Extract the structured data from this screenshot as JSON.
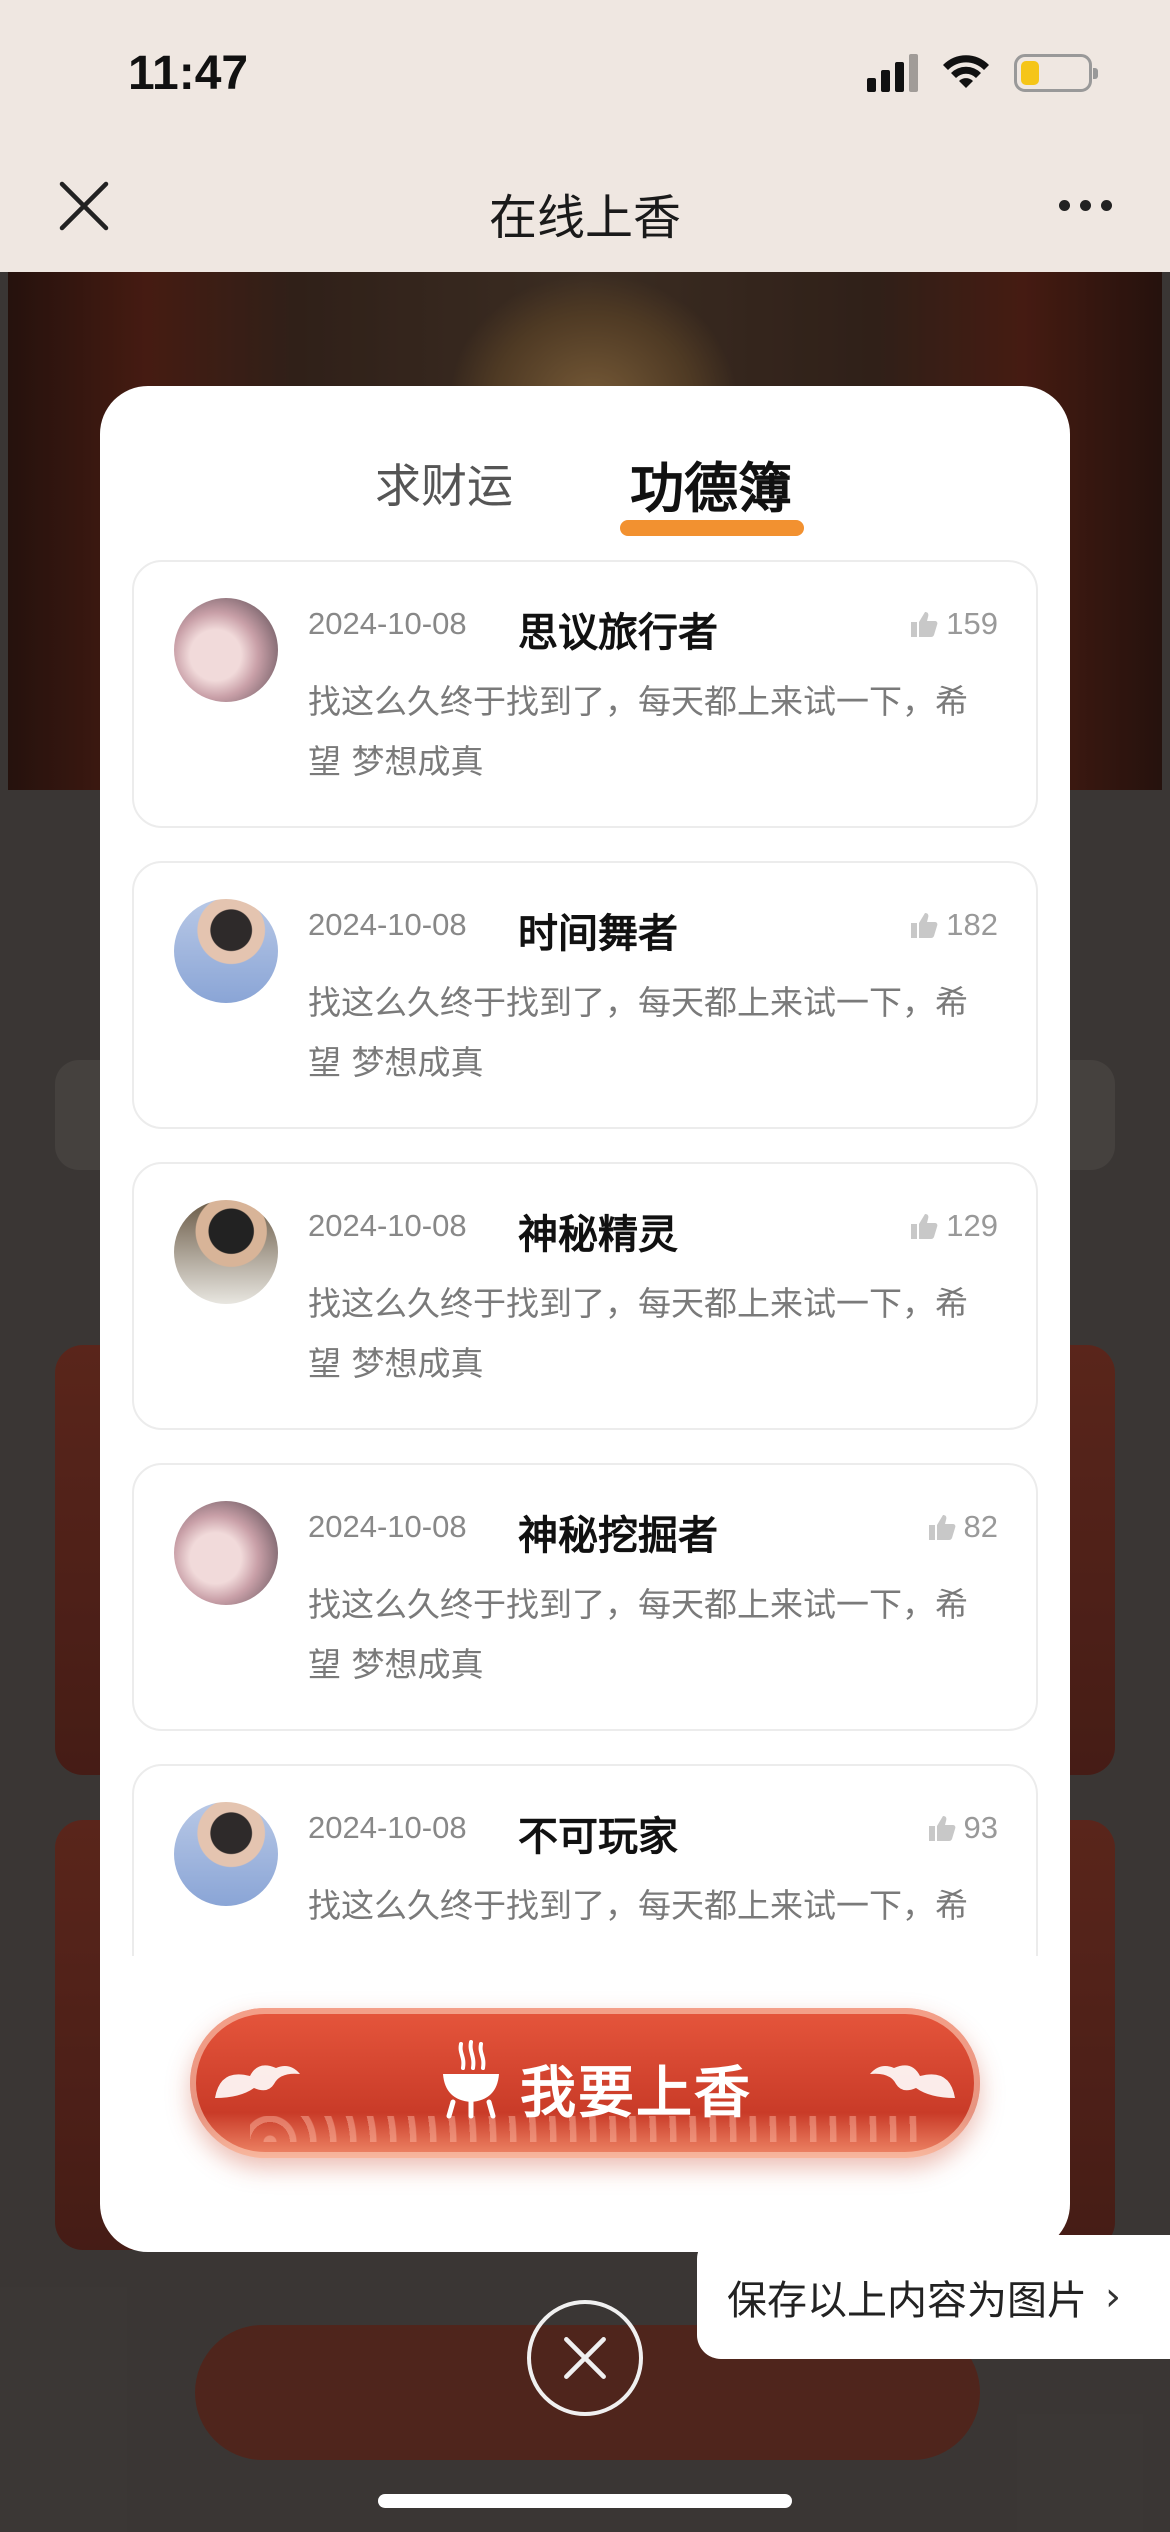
{
  "status_bar": {
    "time": "11:47"
  },
  "nav": {
    "title": "在线上香"
  },
  "tabs": [
    {
      "label": "求财运",
      "active": false
    },
    {
      "label": "功德簿",
      "active": true
    }
  ],
  "accent_color": "#f29130",
  "entries": [
    {
      "date": "2024-10-08",
      "name": "思议旅行者",
      "likes": "159",
      "message": "找这么久终于找到了，每天都上来试一下，希望 梦想成真"
    },
    {
      "date": "2024-10-08",
      "name": "时间舞者",
      "likes": "182",
      "message": "找这么久终于找到了，每天都上来试一下，希望 梦想成真"
    },
    {
      "date": "2024-10-08",
      "name": "神秘精灵",
      "likes": "129",
      "message": "找这么久终于找到了，每天都上来试一下，希望 梦想成真"
    },
    {
      "date": "2024-10-08",
      "name": "神秘挖掘者",
      "likes": "82",
      "message": "找这么久终于找到了，每天都上来试一下，希望 梦想成真"
    },
    {
      "date": "2024-10-08",
      "name": "不可玩家",
      "likes": "93",
      "message": "找这么久终于找到了，每天都上来试一下，希"
    }
  ],
  "cta": {
    "label": "我要上香"
  },
  "save_hint": {
    "label": "保存以上内容为图片"
  }
}
